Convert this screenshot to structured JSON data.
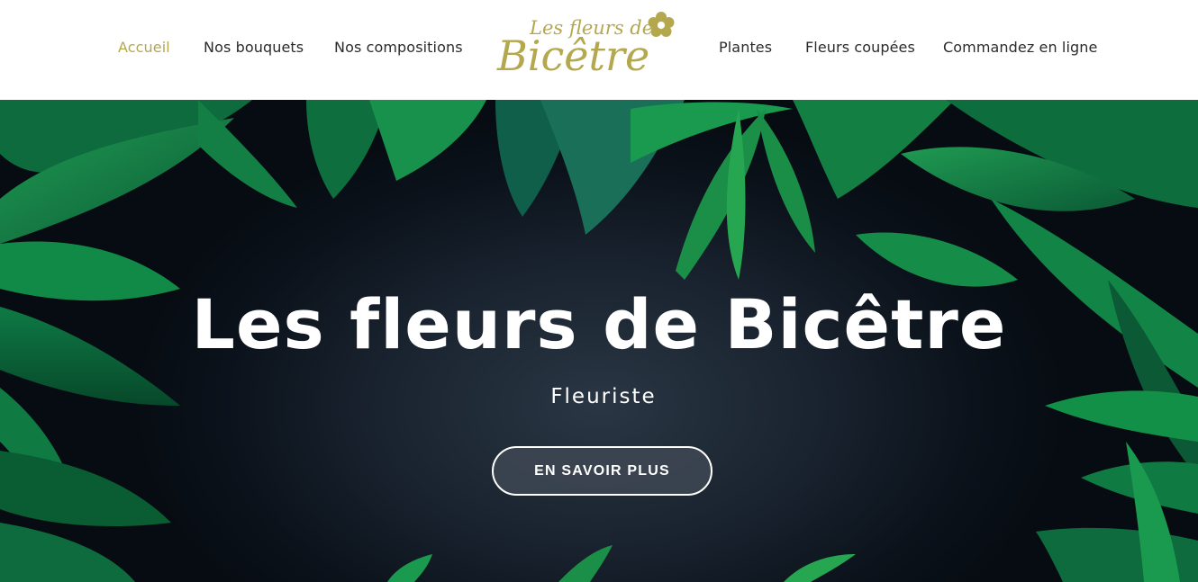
{
  "nav": {
    "left": [
      {
        "label": "Accueil",
        "active": true
      },
      {
        "label": "Nos bouquets",
        "active": false
      },
      {
        "label": "Nos compositions",
        "active": false
      }
    ],
    "right": [
      {
        "label": "Plantes",
        "active": false
      },
      {
        "label": "Fleurs coupées",
        "active": false
      },
      {
        "label": "Commandez en ligne",
        "active": false
      }
    ]
  },
  "logo": {
    "line1": "Les fleurs de",
    "line2": "Bicêtre",
    "icon": "flower-icon",
    "color": "#b4a84f"
  },
  "hero": {
    "title": "Les fleurs de Bicêtre",
    "subtitle": "Fleuriste",
    "cta_label": "EN SAVOIR PLUS"
  },
  "colors": {
    "accent": "#b4a84f",
    "nav_text": "#2b2b2b",
    "leaf_dark": "#0b5a35",
    "leaf_light": "#1f9a52"
  }
}
